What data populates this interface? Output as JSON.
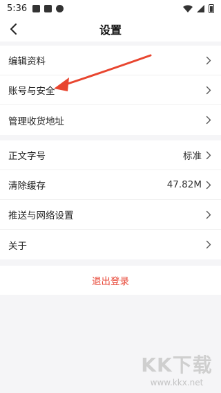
{
  "status_bar": {
    "time": "5:36"
  },
  "header": {
    "title": "设置"
  },
  "group1": [
    {
      "label": "编辑资料"
    },
    {
      "label": "账号与安全"
    },
    {
      "label": "管理收货地址"
    }
  ],
  "group2": [
    {
      "label": "正文字号",
      "value": "标准"
    },
    {
      "label": "清除缓存",
      "value": "47.82M"
    },
    {
      "label": "推送与网络设置"
    },
    {
      "label": "关于"
    }
  ],
  "logout": {
    "label": "退出登录"
  },
  "annotation": {
    "color": "#e8452f"
  },
  "watermark": {
    "text": "KK下载",
    "url": "www.kkx.net"
  },
  "colors": {
    "logout": "#e84a3a",
    "background": "#f5f5f7"
  }
}
